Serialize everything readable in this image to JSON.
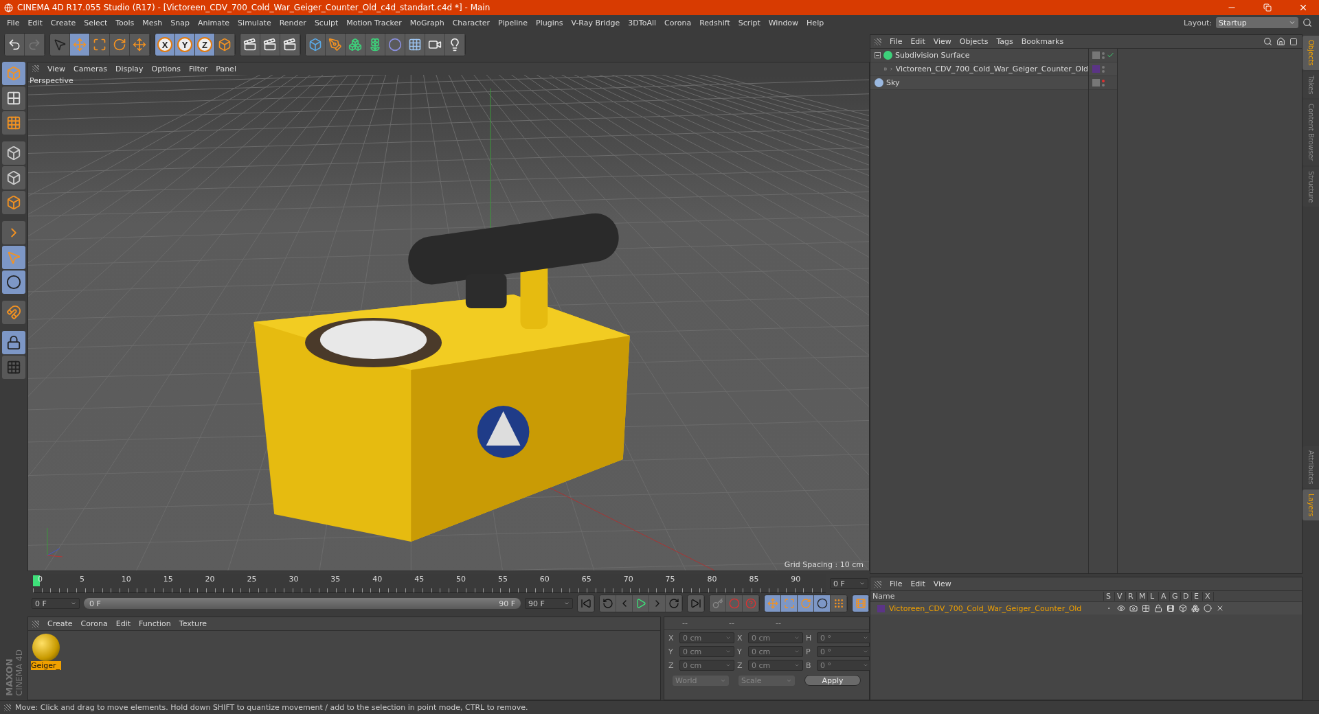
{
  "window": {
    "title": "CINEMA 4D R17.055 Studio (R17) - [Victoreen_CDV_700_Cold_War_Geiger_Counter_Old_c4d_standart.c4d *] - Main"
  },
  "menu": [
    "File",
    "Edit",
    "Create",
    "Select",
    "Tools",
    "Mesh",
    "Snap",
    "Animate",
    "Simulate",
    "Render",
    "Sculpt",
    "Motion Tracker",
    "MoGraph",
    "Character",
    "Pipeline",
    "Plugins",
    "V-Ray Bridge",
    "3DToAll",
    "Corona",
    "Redshift",
    "Script",
    "Window",
    "Help"
  ],
  "layout": {
    "label": "Layout:",
    "value": "Startup"
  },
  "toolbar": [
    {
      "kind": "undo",
      "selected": false
    },
    {
      "kind": "redo",
      "selected": false
    },
    {
      "kind": "select",
      "selected": false
    },
    {
      "kind": "move",
      "selected": true
    },
    {
      "kind": "scale",
      "selected": false
    },
    {
      "kind": "rotate",
      "selected": false
    },
    {
      "kind": "move",
      "selected": false
    },
    {
      "kind": "axis",
      "label": "X",
      "selected": true
    },
    {
      "kind": "axis",
      "label": "Y",
      "selected": true
    },
    {
      "kind": "axis",
      "label": "Z",
      "selected": true
    },
    {
      "kind": "coords",
      "selected": false
    },
    {
      "kind": "render-view",
      "selected": false
    },
    {
      "kind": "render",
      "selected": false
    },
    {
      "kind": "render-settings",
      "selected": false
    },
    {
      "kind": "cube",
      "selected": false
    },
    {
      "kind": "pen",
      "selected": false
    },
    {
      "kind": "subdivision",
      "selected": false
    },
    {
      "kind": "cloner",
      "selected": false
    },
    {
      "kind": "deformer",
      "selected": false
    },
    {
      "kind": "floor",
      "selected": false
    },
    {
      "kind": "camera",
      "selected": false
    },
    {
      "kind": "light",
      "selected": false
    }
  ],
  "left_toolbar": [
    {
      "kind": "model",
      "selected": true
    },
    {
      "kind": "texture",
      "selected": false
    },
    {
      "kind": "workplane",
      "selected": false
    },
    {
      "kind": "points",
      "selected": false
    },
    {
      "kind": "edges",
      "selected": false
    },
    {
      "kind": "polygons",
      "selected": false
    },
    {
      "kind": "axis",
      "selected": false
    },
    {
      "kind": "tweak",
      "selected": true
    },
    {
      "kind": "snap",
      "selected": true
    },
    {
      "kind": "magnet",
      "selected": false
    },
    {
      "kind": "lock",
      "selected": true
    },
    {
      "kind": "grid",
      "selected": false
    }
  ],
  "logo": {
    "brand": "MAXON",
    "product": "CINEMA 4D"
  },
  "viewport": {
    "menu": [
      "View",
      "Cameras",
      "Display",
      "Options",
      "Filter",
      "Panel"
    ],
    "camera": "Perspective",
    "grid_spacing": "Grid Spacing : 10 cm"
  },
  "object_manager": {
    "menu": [
      "File",
      "Edit",
      "View",
      "Objects",
      "Tags",
      "Bookmarks"
    ],
    "objects": [
      {
        "name": "Subdivision Surface",
        "kind": "subdivision",
        "expanded": true,
        "enabled": true,
        "editor_visible": true,
        "children": [
          {
            "name": "Victoreen_CDV_700_Cold_War_Geiger_Counter_Old",
            "kind": "null",
            "expanded": false,
            "color": "#5b3486",
            "editor_visible": true
          }
        ]
      },
      {
        "name": "Sky",
        "kind": "sky",
        "editor_visible": false
      }
    ]
  },
  "side_tabs": [
    {
      "label": "Objects",
      "selected": true
    },
    {
      "label": "Takes",
      "selected": false
    },
    {
      "label": "Content Browser",
      "selected": false
    },
    {
      "label": "Structure",
      "selected": false
    }
  ],
  "timeline": {
    "ticks": [
      "0",
      "5",
      "10",
      "15",
      "20",
      "25",
      "30",
      "35",
      "40",
      "45",
      "50",
      "55",
      "60",
      "65",
      "70",
      "75",
      "80",
      "85",
      "90"
    ],
    "level": 0,
    "current": "0 F",
    "start": "0 F",
    "range": {
      "start": "0 F",
      "end": "90 F",
      "level": 1
    },
    "end": "90 F"
  },
  "key_filters": [
    {
      "kind": "move",
      "selected": true
    },
    {
      "kind": "scale",
      "selected": true
    },
    {
      "kind": "rotate",
      "selected": true
    },
    {
      "kind": "param",
      "selected": true
    },
    {
      "kind": "points",
      "selected": false
    }
  ],
  "material_manager": {
    "menu": [
      "Create",
      "Corona",
      "Edit",
      "Function",
      "Texture"
    ],
    "materials": [
      {
        "name": "Geiger_",
        "selected": true
      }
    ]
  },
  "coordinates": {
    "headers": [
      "--",
      "--",
      "--"
    ],
    "rows": [
      {
        "axis": "X",
        "position": "0 cm",
        "size_axis": "X",
        "size": "0 cm",
        "rotation_axis": "H",
        "rotation": "0 °"
      },
      {
        "axis": "Y",
        "position": "0 cm",
        "size_axis": "Y",
        "size": "0 cm",
        "rotation_axis": "P",
        "rotation": "0 °"
      },
      {
        "axis": "Z",
        "position": "0 cm",
        "size_axis": "Z",
        "size": "0 cm",
        "rotation_axis": "B",
        "rotation": "0 °"
      }
    ],
    "space": "World",
    "size_mode": "Scale",
    "apply": "Apply"
  },
  "layer_manager": {
    "menu": [
      "File",
      "Edit",
      "View"
    ],
    "columns": [
      "Name",
      "S",
      "V",
      "R",
      "M",
      "L",
      "A",
      "G",
      "D",
      "E",
      "X"
    ],
    "layers": [
      {
        "name": "Victoreen_CDV_700_Cold_War_Geiger_Counter_Old",
        "color": "#5b3486"
      }
    ]
  },
  "lower_side_tabs": [
    {
      "label": "Attributes",
      "selected": false
    },
    {
      "label": "Layers",
      "selected": true
    }
  ],
  "status_bar": "Move: Click and drag to move elements. Hold down SHIFT to quantize movement / add to the selection in point mode, CTRL to remove."
}
